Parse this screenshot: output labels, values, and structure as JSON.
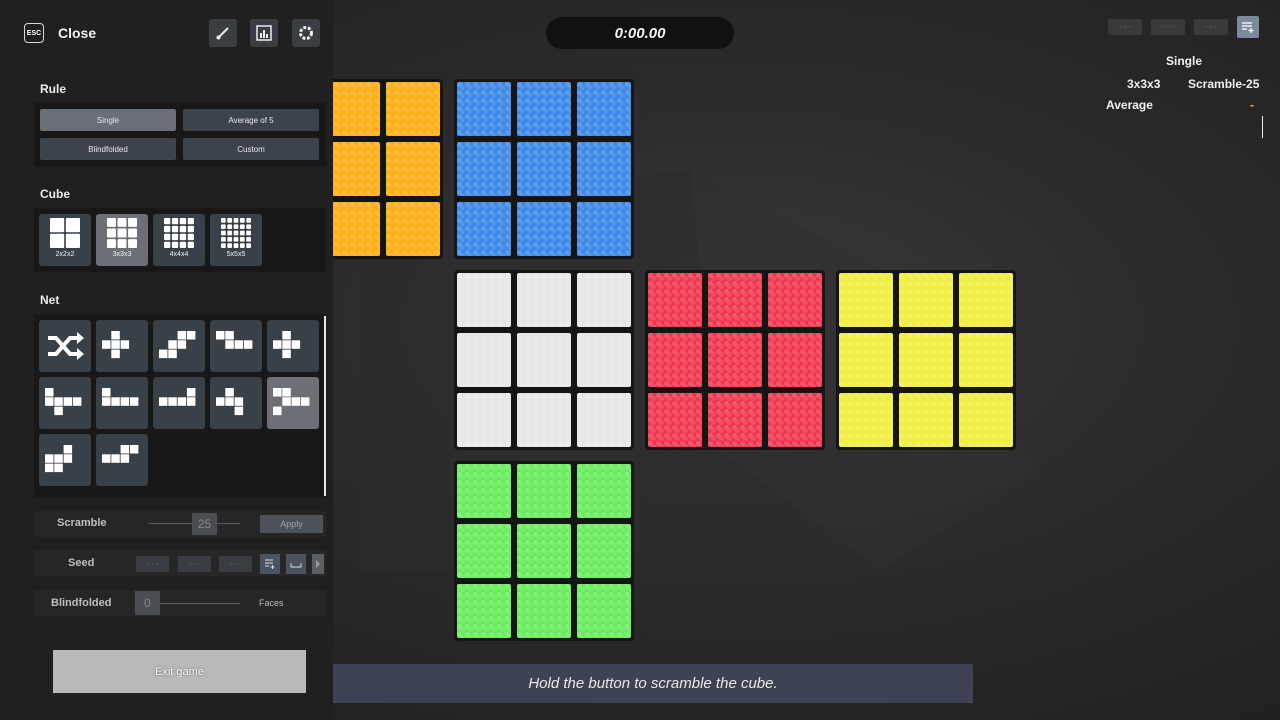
{
  "topbar": {
    "esc_label": "ESC",
    "close_label": "Close",
    "icons": [
      "brush-icon",
      "stats-icon",
      "gear-icon"
    ]
  },
  "timer": {
    "value": "0:00.00"
  },
  "rule": {
    "title": "Rule",
    "options": [
      "Single",
      "Average of 5",
      "Blindfolded",
      "Custom"
    ],
    "selected": "Single"
  },
  "cube": {
    "title": "Cube",
    "options": [
      "2x2x2",
      "3x3x3",
      "4x4x4",
      "5x5x5"
    ],
    "selected": "3x3x3"
  },
  "net": {
    "title": "Net",
    "selected_index": 9
  },
  "scramble": {
    "label": "Scramble",
    "value": "25",
    "apply_label": "Apply"
  },
  "seed": {
    "label": "Seed",
    "fields": [
      "- - -",
      "- - -",
      "- - -"
    ]
  },
  "blindfolded": {
    "label": "Blindfolded",
    "value": "0",
    "faces_label": "Faces"
  },
  "exit_label": "Exit game",
  "stats": {
    "slots": [
      "- - -",
      "- - -",
      "- - -"
    ],
    "mode": "Single",
    "cube": "3x3x3",
    "scramble": "Scramble-25",
    "average_label": "Average",
    "average_value": "-"
  },
  "hint": "Hold the button to scramble the cube.",
  "colors": {
    "orange": "#ffad10",
    "blue": "#3a86e8",
    "white": "#e6e6e6",
    "red": "#f0344e",
    "yellow": "#f0ee3c",
    "green": "#66ec5a",
    "panel": "#202020",
    "accent_yellow": "#f0c020"
  }
}
